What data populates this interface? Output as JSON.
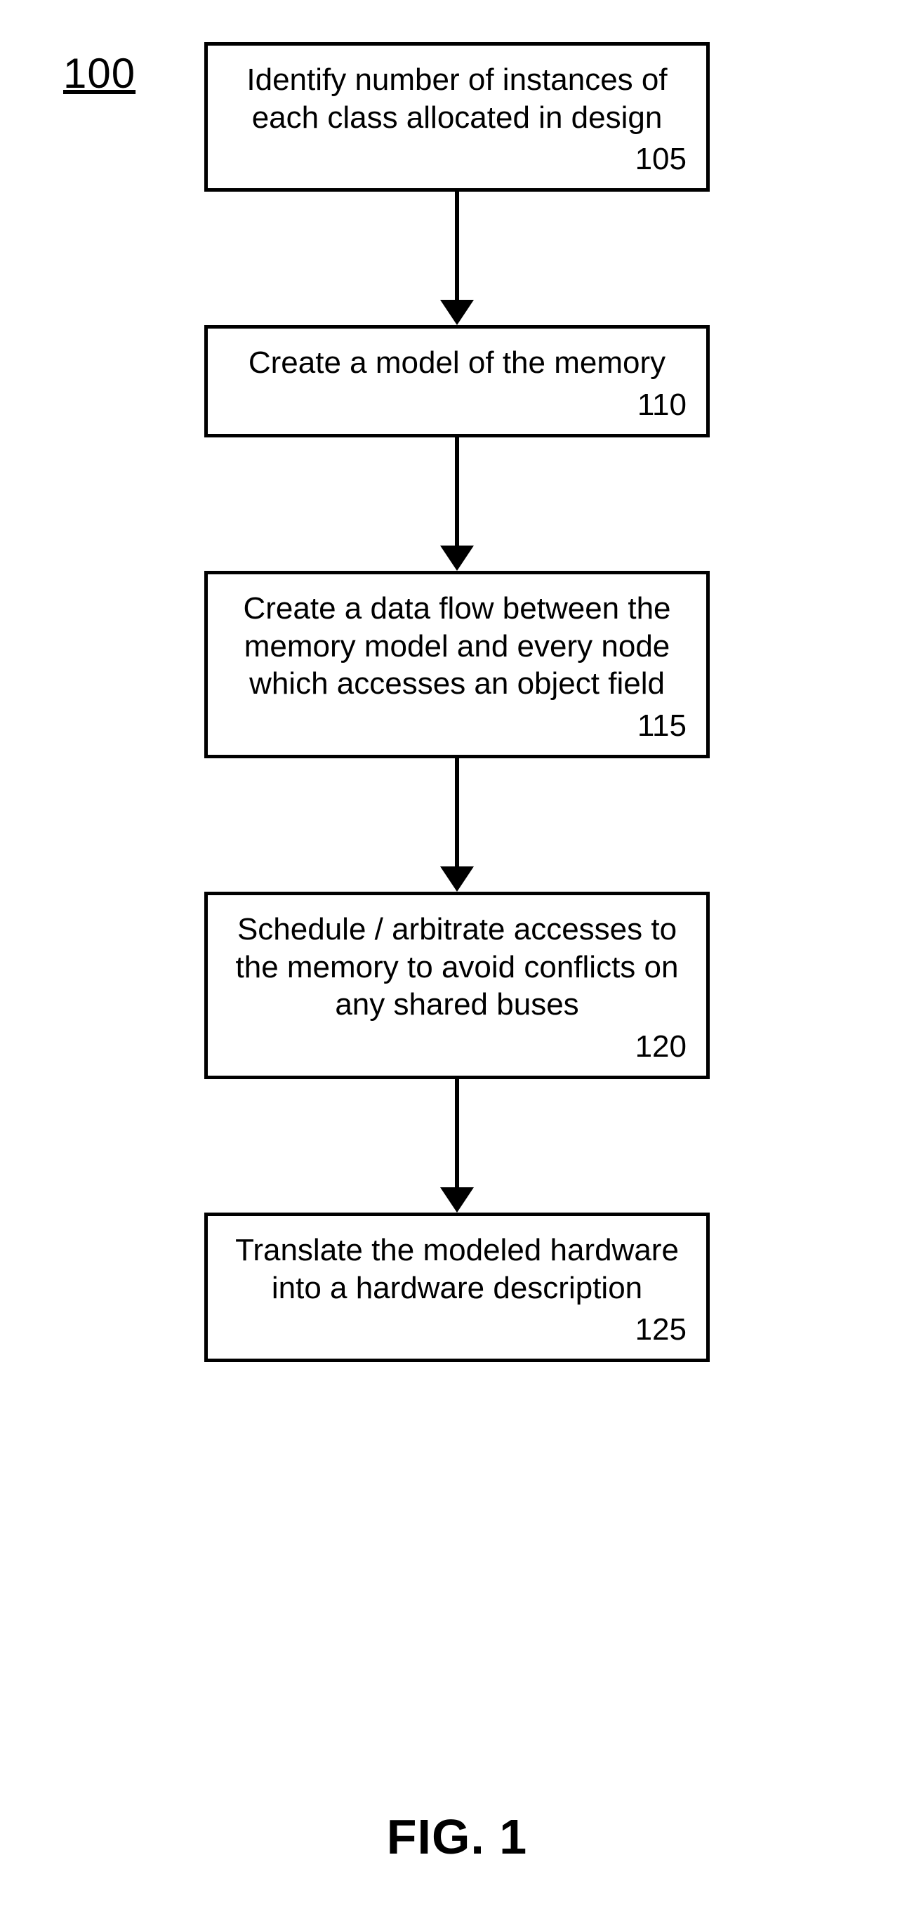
{
  "figure_ref": "100",
  "caption": "FIG. 1",
  "steps": [
    {
      "text": "Identify number of instances of each class allocated in design",
      "num": "105"
    },
    {
      "text": "Create a model of the memory",
      "num": "110"
    },
    {
      "text": "Create a data flow between the memory model and every node which accesses an object field",
      "num": "115"
    },
    {
      "text": "Schedule / arbitrate accesses to the memory to avoid conflicts on any shared buses",
      "num": "120"
    },
    {
      "text": "Translate the modeled hardware into a hardware description",
      "num": "125"
    }
  ]
}
